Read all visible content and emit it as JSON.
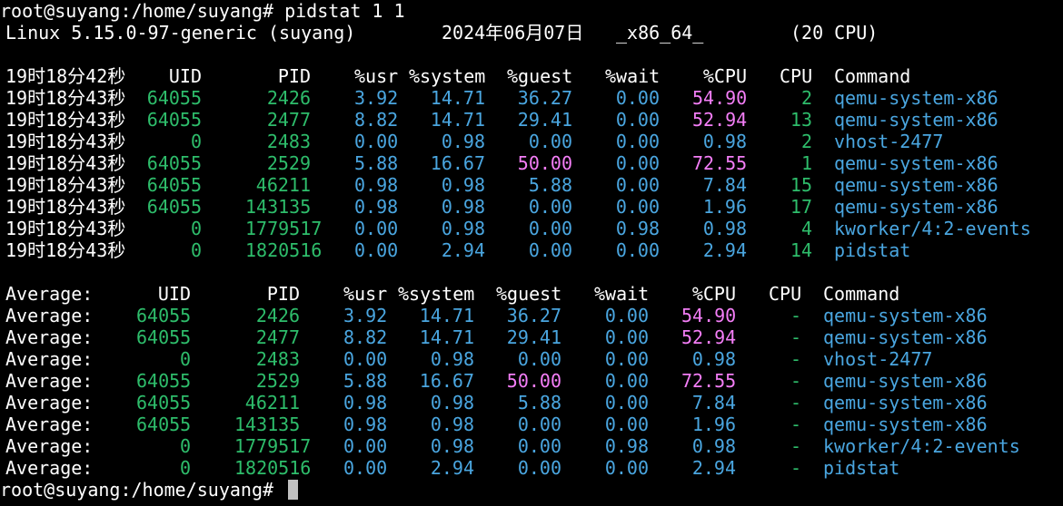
{
  "colors": {
    "background": "#000000",
    "text": "#ffffff",
    "green": "#2ebd6b",
    "blue": "#4aa6e0",
    "magenta": "#f47ef7",
    "cursor": "#c0c0c0"
  },
  "prompt": "root@suyang:/home/suyang# ",
  "command": "pidstat 1 1",
  "sysinfo": {
    "kernel": "Linux 5.15.0-97-generic (suyang)",
    "date": "2024年06月07日",
    "arch": "_x86_64_",
    "cpus": "(20 CPU)"
  },
  "headers": {
    "uid": "UID",
    "pid": "PID",
    "usr": "%usr",
    "system": "%system",
    "guest": "%guest",
    "wait": "%wait",
    "cpu_pct": "%CPU",
    "cpu": "CPU",
    "command": "Command"
  },
  "sample": {
    "header_time": "19时18分42秒",
    "rows": [
      {
        "time": "19时18分43秒",
        "uid": "64055",
        "pid": "2426",
        "usr": "3.92",
        "system": "14.71",
        "guest": "36.27",
        "wait": "0.00",
        "cpu_pct": "54.90",
        "cpu": "2",
        "command": "qemu-system-x86"
      },
      {
        "time": "19时18分43秒",
        "uid": "64055",
        "pid": "2477",
        "usr": "8.82",
        "system": "14.71",
        "guest": "29.41",
        "wait": "0.00",
        "cpu_pct": "52.94",
        "cpu": "13",
        "command": "qemu-system-x86"
      },
      {
        "time": "19时18分43秒",
        "uid": "0",
        "pid": "2483",
        "usr": "0.00",
        "system": "0.98",
        "guest": "0.00",
        "wait": "0.00",
        "cpu_pct": "0.98",
        "cpu": "2",
        "command": "vhost-2477"
      },
      {
        "time": "19时18分43秒",
        "uid": "64055",
        "pid": "2529",
        "usr": "5.88",
        "system": "16.67",
        "guest": "50.00",
        "wait": "0.00",
        "cpu_pct": "72.55",
        "cpu": "1",
        "command": "qemu-system-x86"
      },
      {
        "time": "19时18分43秒",
        "uid": "64055",
        "pid": "46211",
        "usr": "0.98",
        "system": "0.98",
        "guest": "5.88",
        "wait": "0.00",
        "cpu_pct": "7.84",
        "cpu": "15",
        "command": "qemu-system-x86"
      },
      {
        "time": "19时18分43秒",
        "uid": "64055",
        "pid": "143135",
        "usr": "0.98",
        "system": "0.98",
        "guest": "0.00",
        "wait": "0.00",
        "cpu_pct": "1.96",
        "cpu": "17",
        "command": "qemu-system-x86"
      },
      {
        "time": "19时18分43秒",
        "uid": "0",
        "pid": "1779517",
        "usr": "0.00",
        "system": "0.98",
        "guest": "0.00",
        "wait": "0.98",
        "cpu_pct": "0.98",
        "cpu": "4",
        "command": "kworker/4:2-events"
      },
      {
        "time": "19时18分43秒",
        "uid": "0",
        "pid": "1820516",
        "usr": "0.00",
        "system": "2.94",
        "guest": "0.00",
        "wait": "0.00",
        "cpu_pct": "2.94",
        "cpu": "14",
        "command": "pidstat"
      }
    ]
  },
  "average": {
    "label": "Average:",
    "rows": [
      {
        "uid": "64055",
        "pid": "2426",
        "usr": "3.92",
        "system": "14.71",
        "guest": "36.27",
        "wait": "0.00",
        "cpu_pct": "54.90",
        "cpu": "-",
        "command": "qemu-system-x86"
      },
      {
        "uid": "64055",
        "pid": "2477",
        "usr": "8.82",
        "system": "14.71",
        "guest": "29.41",
        "wait": "0.00",
        "cpu_pct": "52.94",
        "cpu": "-",
        "command": "qemu-system-x86"
      },
      {
        "uid": "0",
        "pid": "2483",
        "usr": "0.00",
        "system": "0.98",
        "guest": "0.00",
        "wait": "0.00",
        "cpu_pct": "0.98",
        "cpu": "-",
        "command": "vhost-2477"
      },
      {
        "uid": "64055",
        "pid": "2529",
        "usr": "5.88",
        "system": "16.67",
        "guest": "50.00",
        "wait": "0.00",
        "cpu_pct": "72.55",
        "cpu": "-",
        "command": "qemu-system-x86"
      },
      {
        "uid": "64055",
        "pid": "46211",
        "usr": "0.98",
        "system": "0.98",
        "guest": "5.88",
        "wait": "0.00",
        "cpu_pct": "7.84",
        "cpu": "-",
        "command": "qemu-system-x86"
      },
      {
        "uid": "64055",
        "pid": "143135",
        "usr": "0.98",
        "system": "0.98",
        "guest": "0.00",
        "wait": "0.00",
        "cpu_pct": "1.96",
        "cpu": "-",
        "command": "qemu-system-x86"
      },
      {
        "uid": "0",
        "pid": "1779517",
        "usr": "0.00",
        "system": "0.98",
        "guest": "0.00",
        "wait": "0.98",
        "cpu_pct": "0.98",
        "cpu": "-",
        "command": "kworker/4:2-events"
      },
      {
        "uid": "0",
        "pid": "1820516",
        "usr": "0.00",
        "system": "2.94",
        "guest": "0.00",
        "wait": "0.00",
        "cpu_pct": "2.94",
        "cpu": "-",
        "command": "pidstat"
      }
    ]
  }
}
